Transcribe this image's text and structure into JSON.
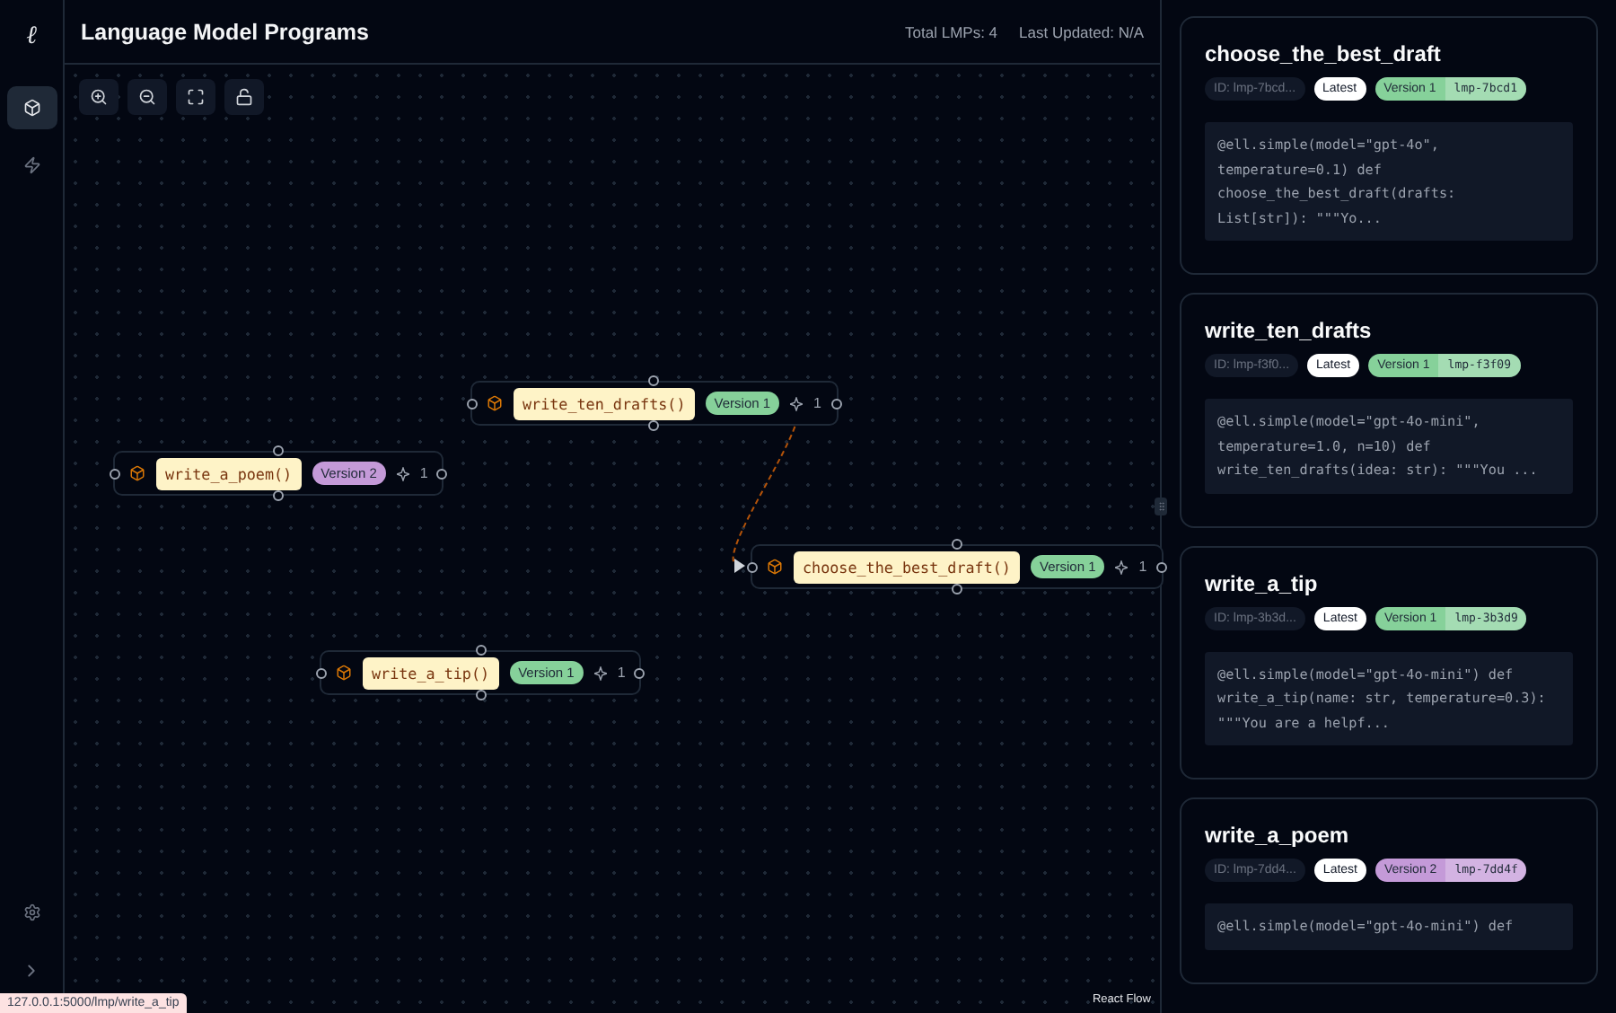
{
  "sidebar": {
    "logo": "ℓ",
    "items": [
      {
        "kind": "cube",
        "selected": true
      },
      {
        "kind": "zap",
        "selected": false
      }
    ],
    "bottom_items": [
      {
        "kind": "settings"
      },
      {
        "kind": "expand"
      }
    ]
  },
  "header": {
    "title": "Language Model Programs",
    "total": "Total LMPs: 4",
    "updated": "Last Updated: N/A"
  },
  "toolbar": [
    {
      "kind": "zoom-in"
    },
    {
      "kind": "zoom-out"
    },
    {
      "kind": "fit"
    },
    {
      "kind": "lock"
    }
  ],
  "nodes": [
    {
      "name": "write_ten_drafts()",
      "version": "Version 1",
      "color": "#86d19a",
      "count": "1"
    },
    {
      "name": "write_a_poem()",
      "version": "Version 2",
      "color": "#c49ad8",
      "count": "1"
    },
    {
      "name": "choose_the_best_draft()",
      "version": "Version 1",
      "color": "#86d19a",
      "count": "1"
    },
    {
      "name": "write_a_tip()",
      "version": "Version 1",
      "color": "#86d19a",
      "count": "1"
    }
  ],
  "attribution": "React Flow",
  "cards": [
    {
      "title": "choose_the_best_draft",
      "id": "ID: lmp-7bcd...",
      "latest": "Latest",
      "version": "Version 1",
      "hash": "lmp-7bcd1",
      "color": "#86d19a",
      "code_lines": [
        "@ell.simple(model=\"gpt-4o\",",
        "temperature=0.1) def",
        "choose_the_best_draft(drafts:",
        "List[str]): \"\"\"Yo..."
      ]
    },
    {
      "title": "write_ten_drafts",
      "id": "ID: lmp-f3f0...",
      "latest": "Latest",
      "version": "Version 1",
      "hash": "lmp-f3f09",
      "color": "#86d19a",
      "code_lines": [
        "@ell.simple(model=\"gpt-4o-mini\",",
        "temperature=1.0, n=10) def",
        "write_ten_drafts(idea: str): \"\"\"You ..."
      ]
    },
    {
      "title": "write_a_tip",
      "id": "ID: lmp-3b3d...",
      "latest": "Latest",
      "version": "Version 1",
      "hash": "lmp-3b3d9",
      "color": "#86d19a",
      "code_lines": [
        "@ell.simple(model=\"gpt-4o-mini\") def",
        "write_a_tip(name: str, temperature=0.3):",
        "\"\"\"You are a helpf..."
      ]
    },
    {
      "title": "write_a_poem",
      "id": "ID: lmp-7dd4...",
      "latest": "Latest",
      "version": "Version 2",
      "hash": "lmp-7dd4f",
      "color": "#c49ad8",
      "code_lines": [
        "@ell.simple(model=\"gpt-4o-mini\") def"
      ]
    }
  ],
  "status_url": "127.0.0.1:5000/lmp/write_a_tip"
}
